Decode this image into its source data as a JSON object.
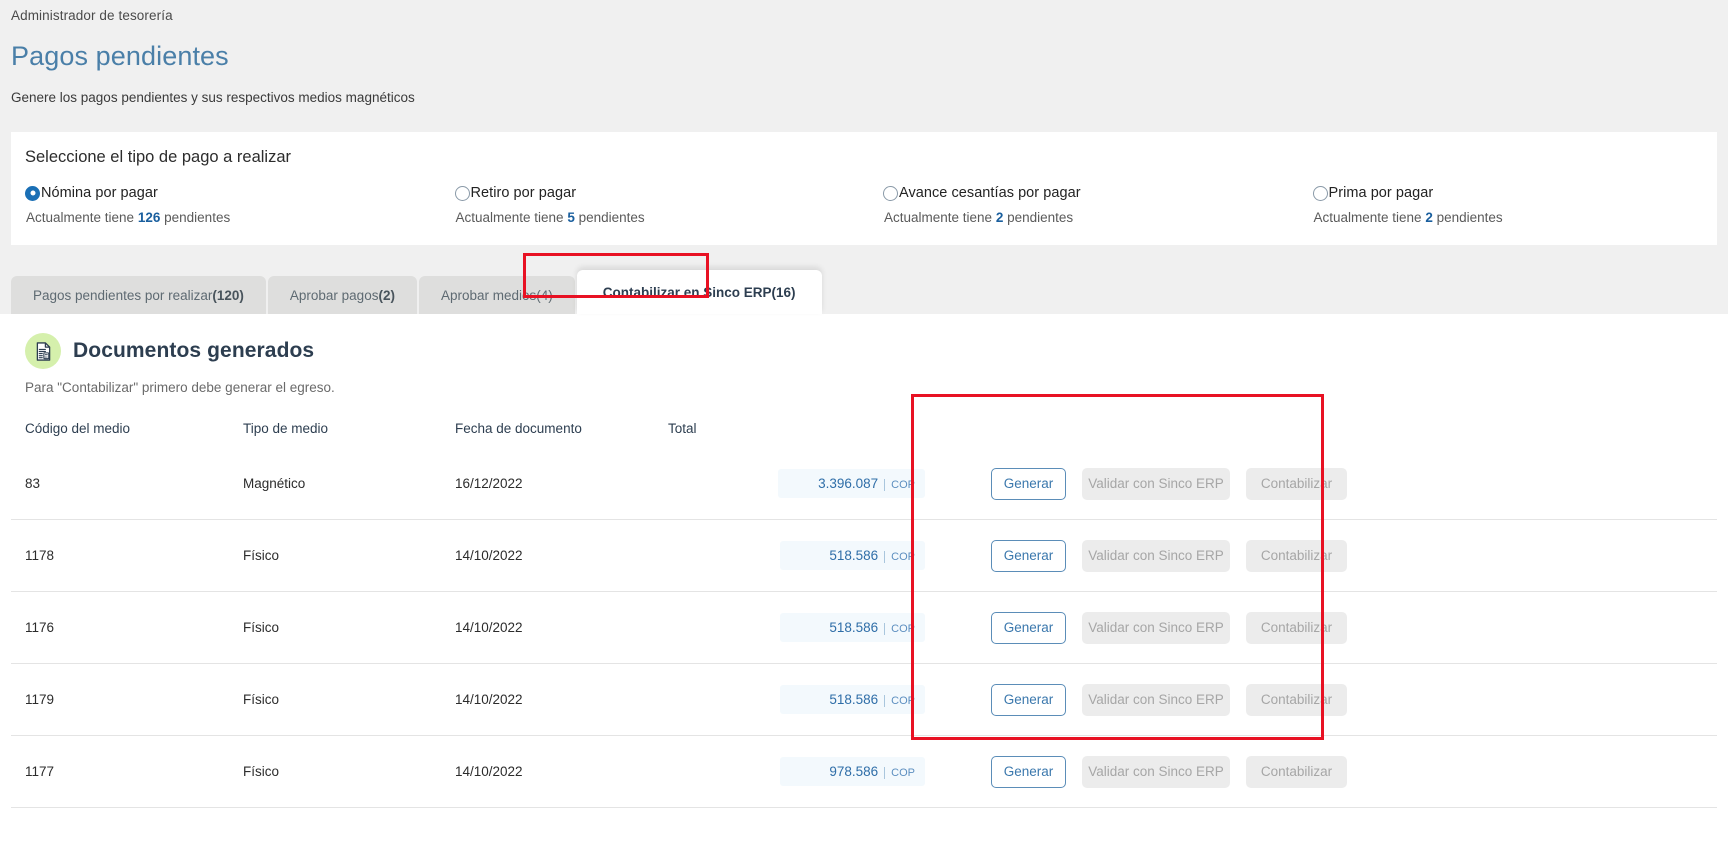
{
  "header": {
    "breadcrumb": "Administrador de tesorería",
    "title": "Pagos pendientes",
    "subtitle": "Genere los pagos pendientes y sus respectivos medios magnéticos"
  },
  "payment_type_card": {
    "title": "Seleccione el tipo de pago a realizar",
    "options": [
      {
        "label": "Nómina por pagar",
        "selected": true,
        "pending_prefix": "Actualmente tiene",
        "pending_count": "126",
        "pending_suffix": "pendientes"
      },
      {
        "label": "Retiro por pagar",
        "selected": false,
        "pending_prefix": "Actualmente tiene",
        "pending_count": "5",
        "pending_suffix": "pendientes"
      },
      {
        "label": "Avance cesantías por pagar",
        "selected": false,
        "pending_prefix": "Actualmente tiene",
        "pending_count": "2",
        "pending_suffix": "pendientes"
      },
      {
        "label": "Prima por pagar",
        "selected": false,
        "pending_prefix": "Actualmente tiene",
        "pending_count": "2",
        "pending_suffix": "pendientes"
      }
    ]
  },
  "tabs": [
    {
      "label": "Pagos pendientes por realizar",
      "count": "(120)",
      "active": false
    },
    {
      "label": "Aprobar pagos",
      "count": "(2)",
      "active": false
    },
    {
      "label": "Aprobar medios",
      "count": "(4)",
      "active": false
    },
    {
      "label": "Contabilizar en Sinco ERP",
      "count": "(16)",
      "active": true
    }
  ],
  "section": {
    "icon": "document-invoice-icon",
    "title": "Documentos generados",
    "subtitle": "Para \"Contabilizar\" primero debe generar el egreso."
  },
  "table": {
    "columns": [
      "Código del medio",
      "Tipo de medio",
      "Fecha de documento",
      "Total"
    ],
    "rows": [
      {
        "codigo": "83",
        "tipo": "Magnético",
        "fecha": "16/12/2022",
        "total": "3.396.087",
        "currency": "COP"
      },
      {
        "codigo": "1178",
        "tipo": "Físico",
        "fecha": "14/10/2022",
        "total": "518.586",
        "currency": "COP"
      },
      {
        "codigo": "1176",
        "tipo": "Físico",
        "fecha": "14/10/2022",
        "total": "518.586",
        "currency": "COP"
      },
      {
        "codigo": "1179",
        "tipo": "Físico",
        "fecha": "14/10/2022",
        "total": "518.586",
        "currency": "COP"
      },
      {
        "codigo": "1177",
        "tipo": "Físico",
        "fecha": "14/10/2022",
        "total": "978.586",
        "currency": "COP"
      }
    ],
    "actions": {
      "generar": "Generar",
      "validar": "Validar con Sinco ERP",
      "contabilizar": "Contabilizar"
    }
  },
  "colors": {
    "accent_blue": "#4a7fa8",
    "link_blue": "#3b78ad",
    "highlight_red": "#e81123",
    "icon_green": "#d5f0ac",
    "amount_chip_bg": "#f3f9fd"
  }
}
